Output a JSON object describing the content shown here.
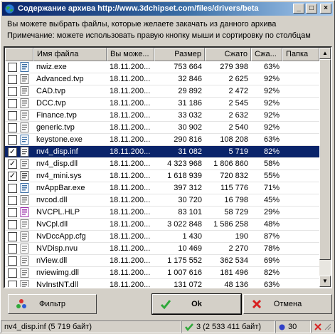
{
  "window": {
    "title": "Содержание архива http://www.3dchipset.com/files/drivers/beta",
    "controls": {
      "minimize": "_",
      "maximize": "□",
      "close": "×"
    }
  },
  "info": {
    "line1": "Вы можете выбрать файлы, которые желаете закачать из данного архива",
    "line2": "Примечание: можете использовать правую кнопку мыши и сортировку по столбцам"
  },
  "columns": [
    "",
    "Имя файла",
    "Вы може...",
    "Размер",
    "Сжато",
    "Сжа...",
    "Папка"
  ],
  "rows": [
    {
      "name": "nwiz.exe",
      "date": "18.11.200...",
      "size": "753 664",
      "compressed": "279 398",
      "ratio": "63%",
      "checked": false,
      "icon": "exe-icon"
    },
    {
      "name": "Advanced.tvp",
      "date": "18.11.200...",
      "size": "32 846",
      "compressed": "2 625",
      "ratio": "92%",
      "checked": false,
      "icon": "tvp-icon"
    },
    {
      "name": "CAD.tvp",
      "date": "18.11.200...",
      "size": "29 892",
      "compressed": "2 472",
      "ratio": "92%",
      "checked": false,
      "icon": "tvp-icon"
    },
    {
      "name": "DCC.tvp",
      "date": "18.11.200...",
      "size": "31 186",
      "compressed": "2 545",
      "ratio": "92%",
      "checked": false,
      "icon": "tvp-icon"
    },
    {
      "name": "Finance.tvp",
      "date": "18.11.200...",
      "size": "33 032",
      "compressed": "2 632",
      "ratio": "92%",
      "checked": false,
      "icon": "tvp-icon"
    },
    {
      "name": "generic.tvp",
      "date": "18.11.200...",
      "size": "30 902",
      "compressed": "2 540",
      "ratio": "92%",
      "checked": false,
      "icon": "tvp-icon"
    },
    {
      "name": "keystone.exe",
      "date": "18.11.200...",
      "size": "290 816",
      "compressed": "108 208",
      "ratio": "63%",
      "checked": false,
      "icon": "exe-icon"
    },
    {
      "name": "nv4_disp.inf",
      "date": "18.11.200...",
      "size": "31 082",
      "compressed": "5 719",
      "ratio": "82%",
      "checked": true,
      "selected": true,
      "icon": "inf-icon"
    },
    {
      "name": "nv4_disp.dll",
      "date": "18.11.200...",
      "size": "4 323 968",
      "compressed": "1 806 860",
      "ratio": "58%",
      "checked": true,
      "icon": "dll-icon"
    },
    {
      "name": "nv4_mini.sys",
      "date": "18.11.200...",
      "size": "1 618 939",
      "compressed": "720 832",
      "ratio": "55%",
      "checked": true,
      "icon": "sys-icon"
    },
    {
      "name": "nvAppBar.exe",
      "date": "18.11.200...",
      "size": "397 312",
      "compressed": "115 776",
      "ratio": "71%",
      "checked": false,
      "icon": "exe-icon"
    },
    {
      "name": "nvcod.dll",
      "date": "18.11.200...",
      "size": "30 720",
      "compressed": "16 798",
      "ratio": "45%",
      "checked": false,
      "icon": "dll-icon"
    },
    {
      "name": "NVCPL.HLP",
      "date": "18.11.200...",
      "size": "83 101",
      "compressed": "58 729",
      "ratio": "29%",
      "checked": false,
      "icon": "hlp-icon"
    },
    {
      "name": "NvCpl.dll",
      "date": "18.11.200...",
      "size": "3 022 848",
      "compressed": "1 586 258",
      "ratio": "48%",
      "checked": false,
      "icon": "dll-icon"
    },
    {
      "name": "NvDccApp.cfg",
      "date": "18.11.200...",
      "size": "1 430",
      "compressed": "190",
      "ratio": "87%",
      "checked": false,
      "icon": "cfg-icon"
    },
    {
      "name": "NVDisp.nvu",
      "date": "18.11.200...",
      "size": "10 469",
      "compressed": "2 270",
      "ratio": "78%",
      "checked": false,
      "icon": "file-icon"
    },
    {
      "name": "nView.dll",
      "date": "18.11.200...",
      "size": "1 175 552",
      "compressed": "362 534",
      "ratio": "69%",
      "checked": false,
      "icon": "dll-icon"
    },
    {
      "name": "nviewimg.dll",
      "date": "18.11.200...",
      "size": "1 007 616",
      "compressed": "181 496",
      "ratio": "82%",
      "checked": false,
      "icon": "dll-icon"
    },
    {
      "name": "NvInstNT.dll",
      "date": "18.11.200...",
      "size": "131 072",
      "compressed": "48 136",
      "ratio": "63%",
      "checked": false,
      "icon": "dll-icon"
    }
  ],
  "buttons": {
    "filter": "Фильтр",
    "ok": "Ok",
    "cancel": "Отмена"
  },
  "status": {
    "file": "nv4_disp.inf (5 719 байт)",
    "selection": "3 (2 533 411 байт)",
    "count": "30"
  },
  "colors": {
    "selection": "#0a246a",
    "title_start": "#0a246a",
    "title_end": "#a6caf0",
    "face": "#d4d0c8"
  }
}
